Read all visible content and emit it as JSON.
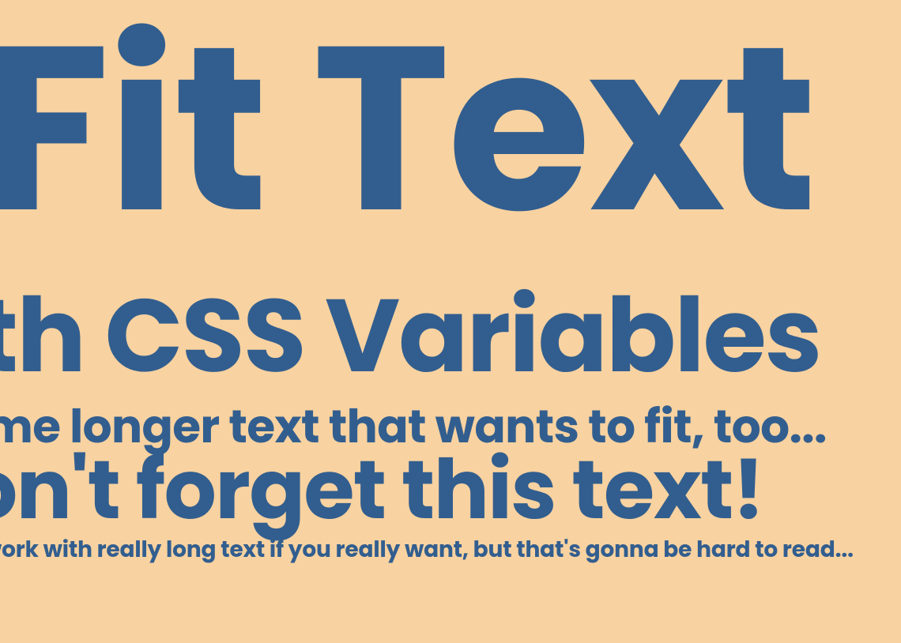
{
  "colors": {
    "background": "#f8d2a0",
    "text": "#325e8f"
  },
  "lines": {
    "line1": "Fit Text",
    "line2": "ith CSS Variables",
    "line3": "ome longer text that wants to fit, too...",
    "line4": "on't forget this text!",
    "line5": "work with really long text if you really want, but that's gonna be hard to read..."
  }
}
